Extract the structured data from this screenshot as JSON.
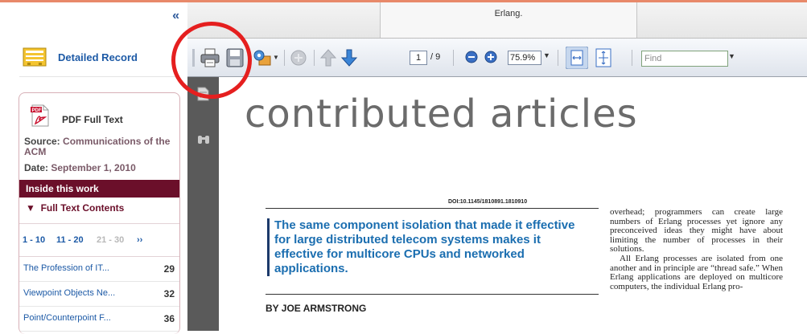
{
  "sidebar": {
    "collapse_glyph": "«",
    "detailed_record_label": "Detailed Record",
    "pdf_full_text_label": "PDF Full Text",
    "source_label": "Source:",
    "source_value": "Communications of the ACM",
    "date_label": "Date:",
    "date_value": "September 1, 2010",
    "inside_this_work_label": "Inside this work",
    "full_text_contents_label": "Full Text Contents",
    "pager": [
      "1 - 10",
      "11 - 20",
      "21 - 30",
      "››"
    ],
    "toc": [
      {
        "title": "The Profession of IT...",
        "page": "29"
      },
      {
        "title": "Viewpoint Objects Ne...",
        "page": "32"
      },
      {
        "title": "Point/Counterpoint F...",
        "page": "36"
      }
    ]
  },
  "viewer": {
    "tab_title": "Erlang.",
    "page_current": "1",
    "page_total": "/ 9",
    "zoom_value": "75.9%",
    "find_placeholder": "Find"
  },
  "document": {
    "section_heading": "contributed articles",
    "doi": "DOI:10.1145/1810891.1810910",
    "lead": "The same component isolation that made it effective for large distributed telecom systems makes it effective for multicore CPUs and networked applications.",
    "byline": "BY JOE ARMSTRONG",
    "body_p1": "overhead; programmers can create large numbers of Erlang processes yet ignore any preconceived ideas they might have about limiting the number of processes in their solutions.",
    "body_p2": "All Erlang processes are isolated from one another and in principle are “thread safe.” When Erlang applications are deployed on multicore computers, the individual Erlang pro-"
  },
  "colors": {
    "accent_maroon": "#6b0f2a",
    "link_blue": "#1d5aa6",
    "annotation_red": "#e51f1f",
    "lead_blue": "#1b6eb0"
  }
}
